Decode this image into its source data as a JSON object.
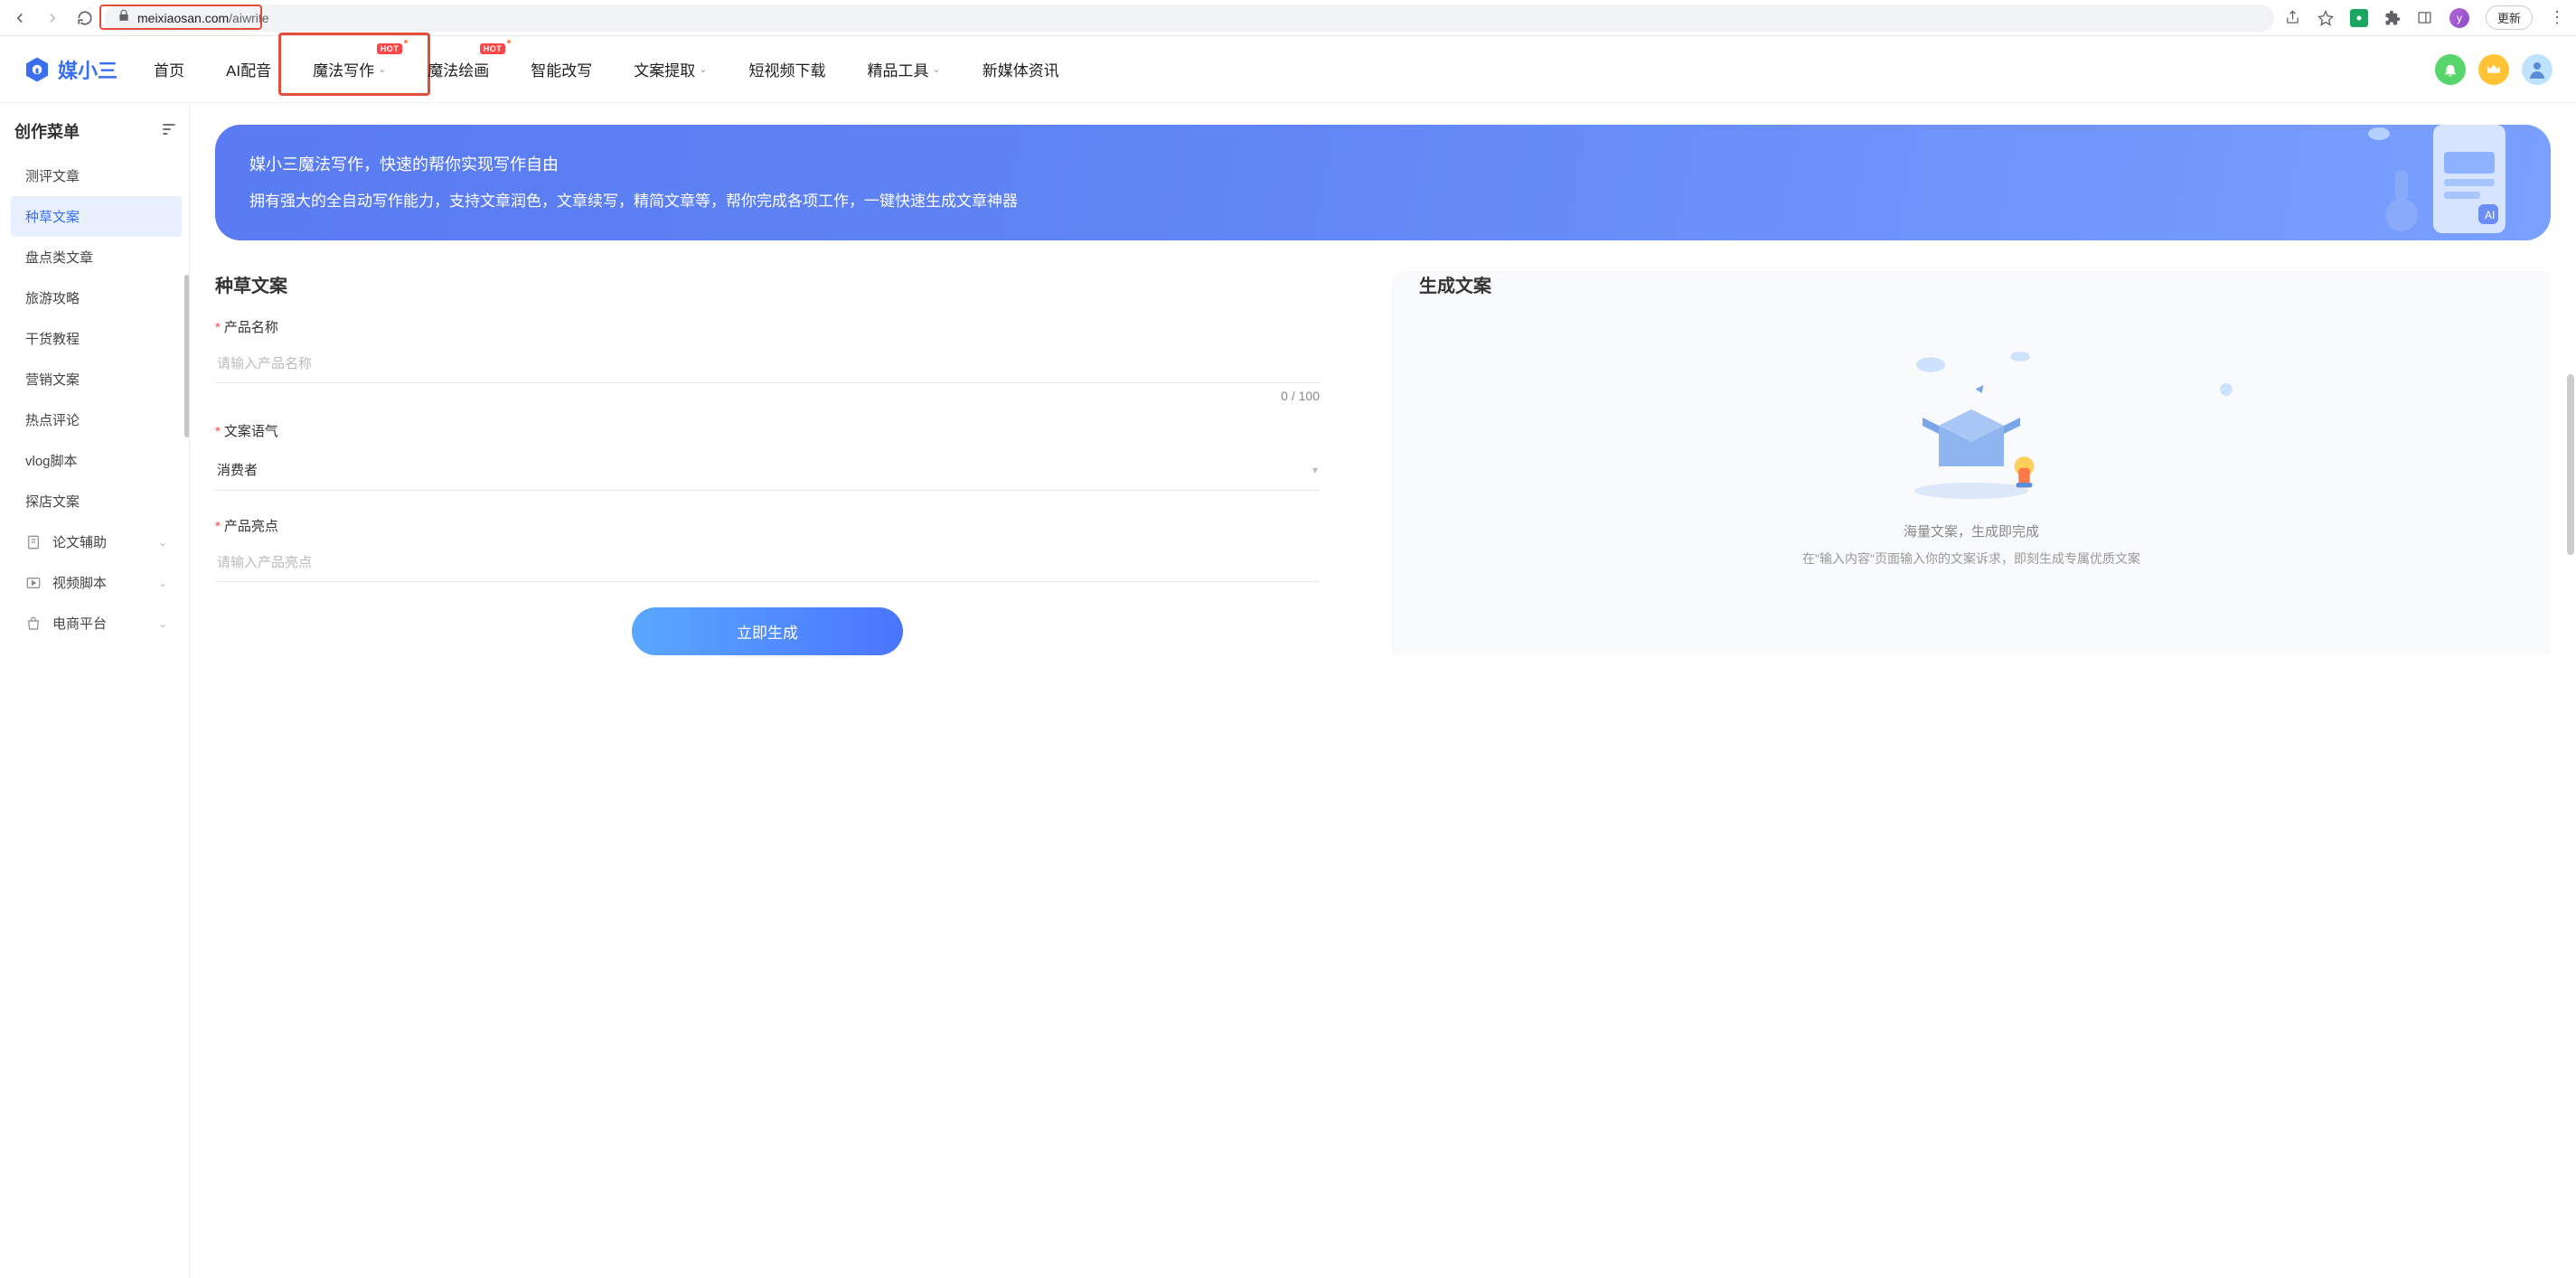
{
  "browser": {
    "url_domain": "meixiaosan.com",
    "url_path": "/aiwrite",
    "update_label": "更新"
  },
  "logo_text": "媒小三",
  "nav": [
    {
      "label": "首页",
      "hot": false,
      "dropdown": false
    },
    {
      "label": "AI配音",
      "hot": false,
      "dropdown": false
    },
    {
      "label": "魔法写作",
      "hot": true,
      "dropdown": true,
      "highlighted": true
    },
    {
      "label": "魔法绘画",
      "hot": true,
      "dropdown": false
    },
    {
      "label": "智能改写",
      "hot": false,
      "dropdown": false
    },
    {
      "label": "文案提取",
      "hot": false,
      "dropdown": true
    },
    {
      "label": "短视频下载",
      "hot": false,
      "dropdown": false
    },
    {
      "label": "精品工具",
      "hot": false,
      "dropdown": true
    },
    {
      "label": "新媒体资讯",
      "hot": false,
      "dropdown": false
    }
  ],
  "hot_label": "HOT",
  "sidebar": {
    "title": "创作菜单",
    "items": [
      {
        "label": "测评文章"
      },
      {
        "label": "种草文案",
        "active": true
      },
      {
        "label": "盘点类文章"
      },
      {
        "label": "旅游攻略"
      },
      {
        "label": "干货教程"
      },
      {
        "label": "营销文案"
      },
      {
        "label": "热点评论"
      },
      {
        "label": "vlog脚本"
      },
      {
        "label": "探店文案"
      }
    ],
    "groups": [
      {
        "label": "论文辅助",
        "icon": "doc"
      },
      {
        "label": "视频脚本",
        "icon": "play"
      },
      {
        "label": "电商平台",
        "icon": "bag"
      }
    ]
  },
  "banner": {
    "title": "媒小三魔法写作，快速的帮你实现写作自由",
    "desc": "拥有强大的全自动写作能力，支持文章润色，文章续写，精简文章等，帮你完成各项工作，一键快速生成文章神器"
  },
  "form": {
    "title": "种草文案",
    "product_label": "产品名称",
    "product_placeholder": "请输入产品名称",
    "product_counter": "0 / 100",
    "tone_label": "文案语气",
    "tone_value": "消费者",
    "highlight_label": "产品亮点",
    "highlight_placeholder": "请输入产品亮点",
    "submit_label": "立即生成"
  },
  "output": {
    "title": "生成文案",
    "empty_hint": "海量文案，生成即完成",
    "empty_sub": "在\"输入内容\"页面输入你的文案诉求，即刻生成专属优质文案"
  }
}
